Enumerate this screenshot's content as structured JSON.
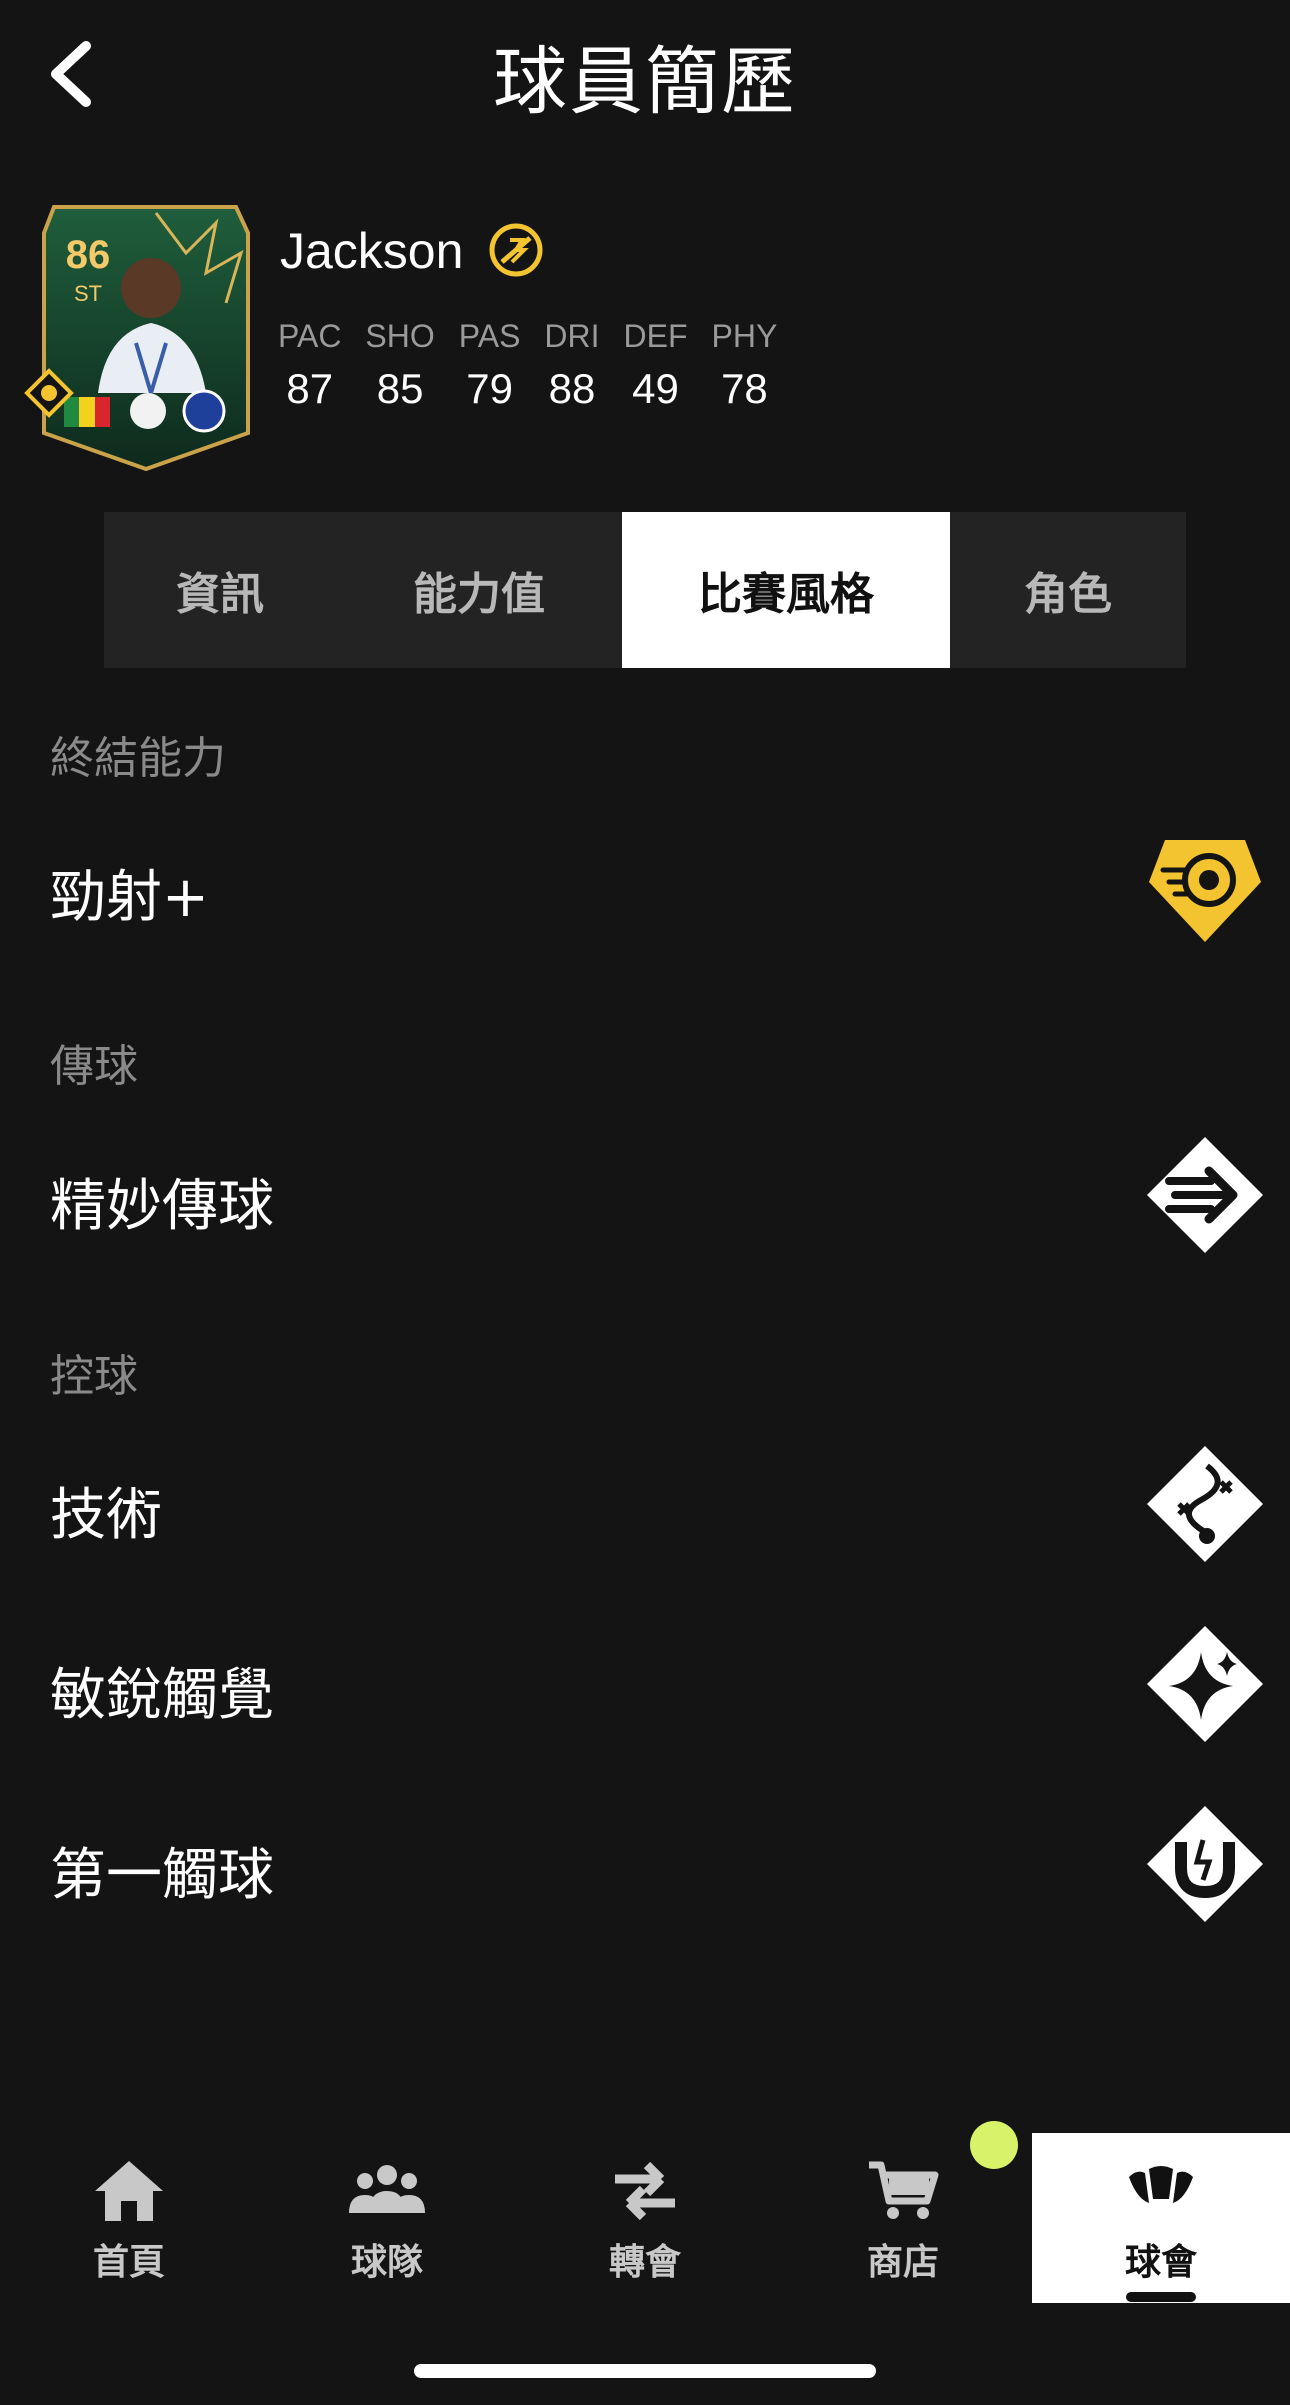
{
  "header": {
    "title": "球員簡歷"
  },
  "player": {
    "name": "Jackson",
    "card": {
      "rating": "86",
      "position": "ST"
    },
    "stats": [
      {
        "label": "PAC",
        "value": "87"
      },
      {
        "label": "SHO",
        "value": "85"
      },
      {
        "label": "PAS",
        "value": "79"
      },
      {
        "label": "DRI",
        "value": "88"
      },
      {
        "label": "DEF",
        "value": "49"
      },
      {
        "label": "PHY",
        "value": "78"
      }
    ]
  },
  "tabs": [
    {
      "label": "資訊"
    },
    {
      "label": "能力值"
    },
    {
      "label": "比賽風格"
    },
    {
      "label": "角色"
    }
  ],
  "active_tab": "比賽風格",
  "sections": [
    {
      "title": "終結能力",
      "items": [
        {
          "label": "勁射+",
          "icon": "power-shot-plus-icon",
          "style": "gold"
        }
      ]
    },
    {
      "title": "傳球",
      "items": [
        {
          "label": "精妙傳球",
          "icon": "incisive-pass-icon",
          "style": "white"
        }
      ]
    },
    {
      "title": "控球",
      "items": [
        {
          "label": "技術",
          "icon": "technical-icon",
          "style": "white"
        },
        {
          "label": "敏銳觸覺",
          "icon": "sparkle-icon",
          "style": "white"
        },
        {
          "label": "第一觸球",
          "icon": "magnet-icon",
          "style": "white"
        }
      ]
    }
  ],
  "bottom_nav": [
    {
      "label": "首頁",
      "icon": "home-icon"
    },
    {
      "label": "球隊",
      "icon": "team-icon"
    },
    {
      "label": "轉會",
      "icon": "transfer-icon"
    },
    {
      "label": "商店",
      "icon": "cart-icon"
    },
    {
      "label": "球會",
      "icon": "club-icon"
    }
  ],
  "active_nav": "球會",
  "colors": {
    "background": "#141414",
    "gold": "#f4c430",
    "notification": "#d8f36a",
    "tab_bg": "#232323"
  }
}
